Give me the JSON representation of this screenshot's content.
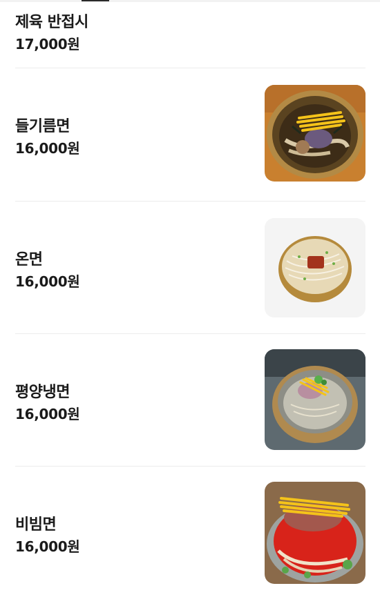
{
  "menu": {
    "items": [
      {
        "name": "제육 반접시",
        "price": "17,000원"
      },
      {
        "name": "들기름면",
        "price": "16,000원",
        "photo": "perilla-oil-noodles-photo"
      },
      {
        "name": "온면",
        "price": "16,000원",
        "photo": "warm-noodle-soup-photo"
      },
      {
        "name": "평양냉면",
        "price": "16,000원",
        "photo": "pyongyang-cold-noodles-photo"
      },
      {
        "name": "비빔면",
        "price": "16,000원",
        "photo": "spicy-mixed-noodles-photo"
      }
    ]
  },
  "colors": {
    "text": "#1a1a1a",
    "divider": "#ececec",
    "egg": "#f2c318",
    "chili": "#d8231a",
    "brass": "#c49a52"
  }
}
